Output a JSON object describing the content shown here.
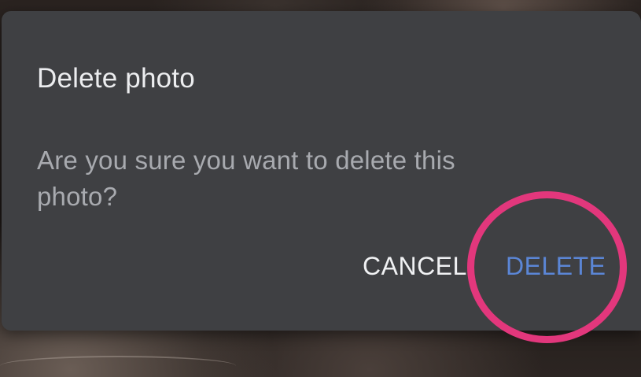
{
  "dialog": {
    "title": "Delete photo",
    "message": "Are you sure you want to delete this photo?",
    "cancel_label": "CANCEL",
    "delete_label": "DELETE"
  },
  "colors": {
    "dialog_background": "#3f4043",
    "title_text": "#ecedef",
    "message_text": "#a8aaaf",
    "cancel_text": "#f0f1f3",
    "delete_text": "#5b86d6",
    "highlight_ring": "#e2377c"
  }
}
